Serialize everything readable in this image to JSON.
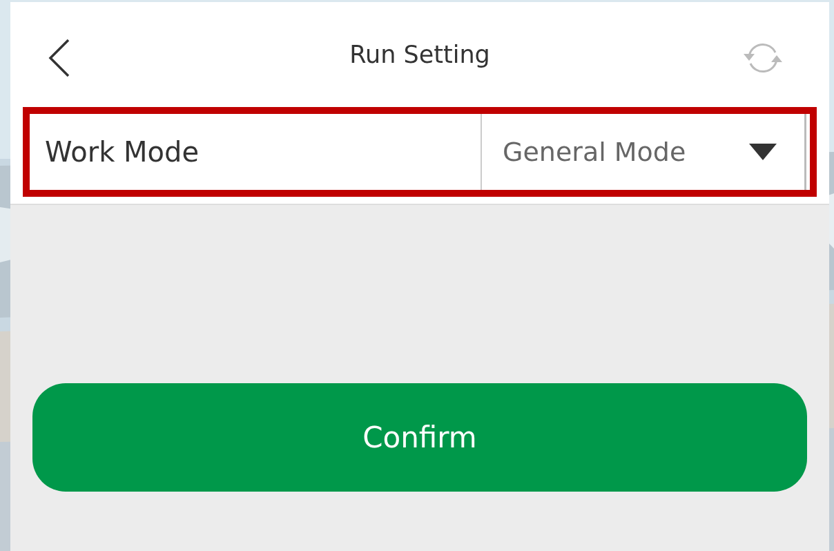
{
  "header": {
    "title": "Run Setting"
  },
  "setting": {
    "label": "Work Mode",
    "value": "General Mode",
    "highlighted": true
  },
  "confirm_button": {
    "label": "Confirm"
  }
}
